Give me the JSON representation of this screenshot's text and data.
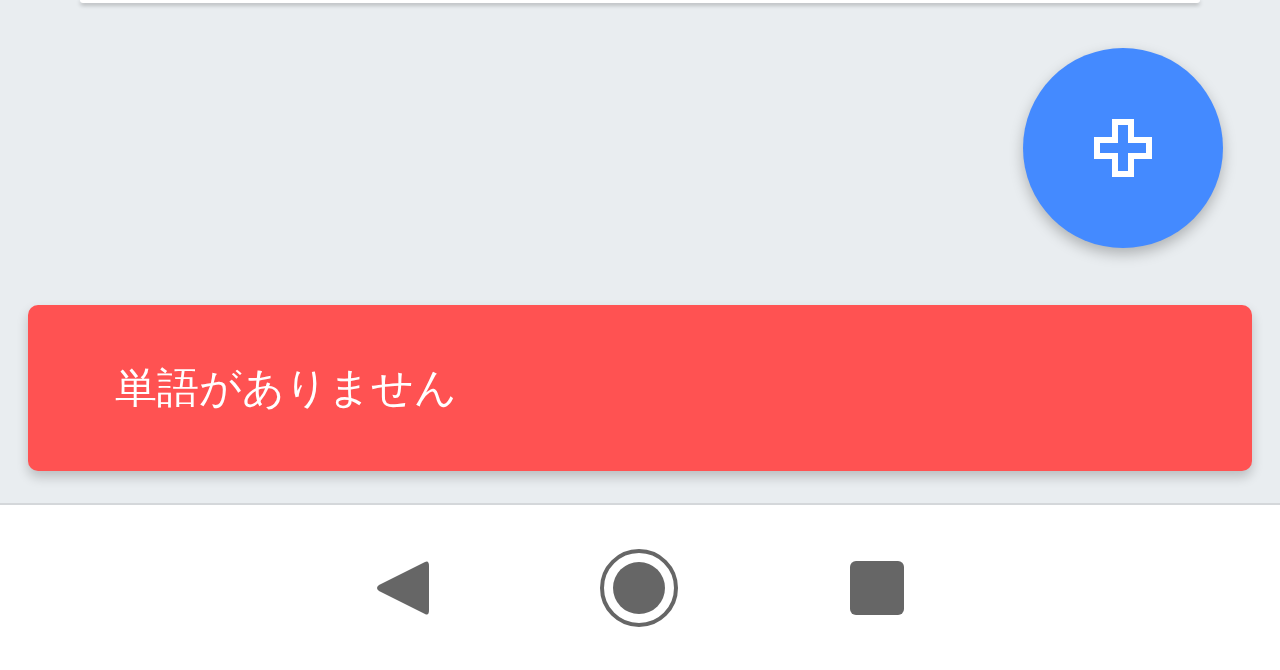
{
  "snackbar": {
    "message": "単語がありません"
  }
}
